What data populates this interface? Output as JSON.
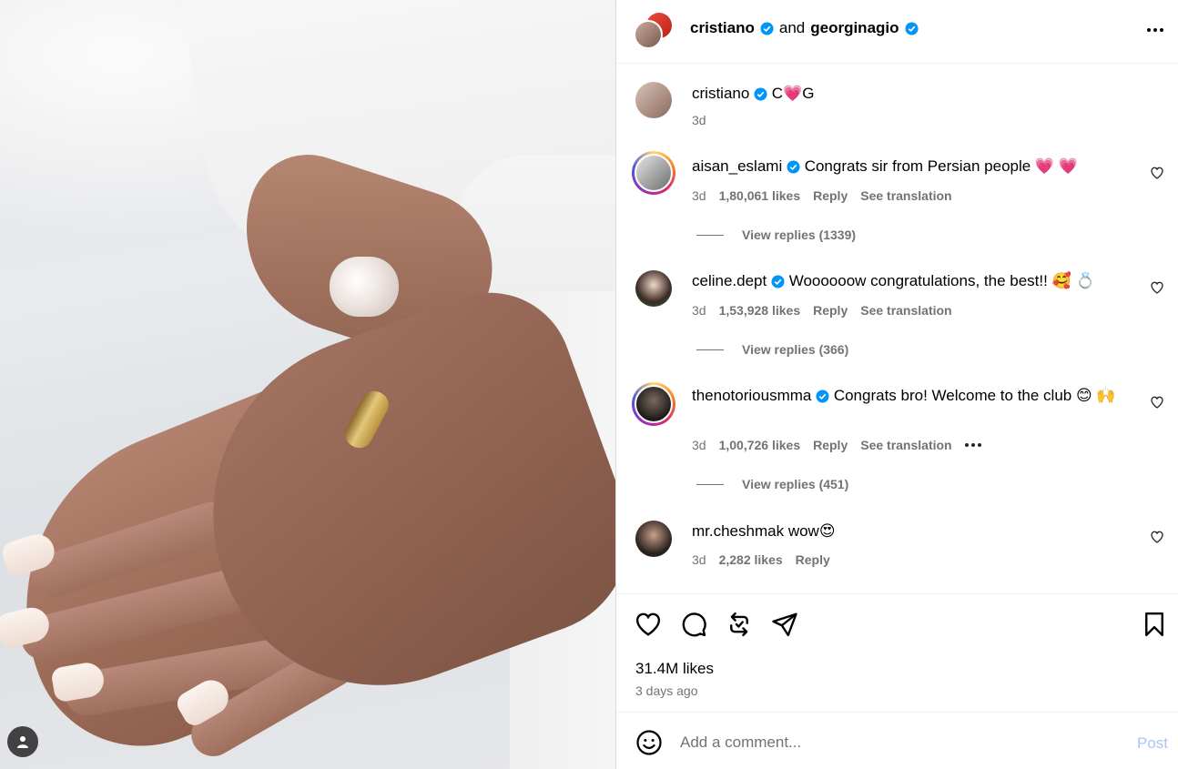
{
  "header": {
    "user1": "cristiano",
    "and_label": "and",
    "user2": "georginagio"
  },
  "caption": {
    "username": "cristiano",
    "text": "C💗G",
    "time": "3d"
  },
  "comments": [
    {
      "username": "aisan_eslami",
      "text": "Congrats sir from Persian people 💗 💗",
      "time": "3d",
      "likes": "1,80,061 likes",
      "reply": "Reply",
      "translation": "See translation",
      "view_replies": "View replies (1339)"
    },
    {
      "username": "celine.dept",
      "text": "Woooooow congratulations, the best!! 🥰 💍",
      "time": "3d",
      "likes": "1,53,928 likes",
      "reply": "Reply",
      "translation": "See translation",
      "view_replies": "View replies (366)"
    },
    {
      "username": "thenotoriousmma",
      "text": "Congrats bro! Welcome to the club 😊 🙌",
      "time": "3d",
      "likes": "1,00,726 likes",
      "reply": "Reply",
      "translation": "See translation",
      "view_replies": "View replies (451)"
    },
    {
      "username": "mr.cheshmak",
      "text": "wow😍",
      "time": "3d",
      "likes": "2,282 likes",
      "reply": "Reply"
    }
  ],
  "post": {
    "likes": "31.4M likes",
    "time_ago": "3 days ago"
  },
  "add_comment": {
    "placeholder": "Add a comment...",
    "post_label": "Post"
  },
  "colors": {
    "verified": "#0095f6",
    "muted": "#737373",
    "post_disabled": "#a5c7f5"
  }
}
